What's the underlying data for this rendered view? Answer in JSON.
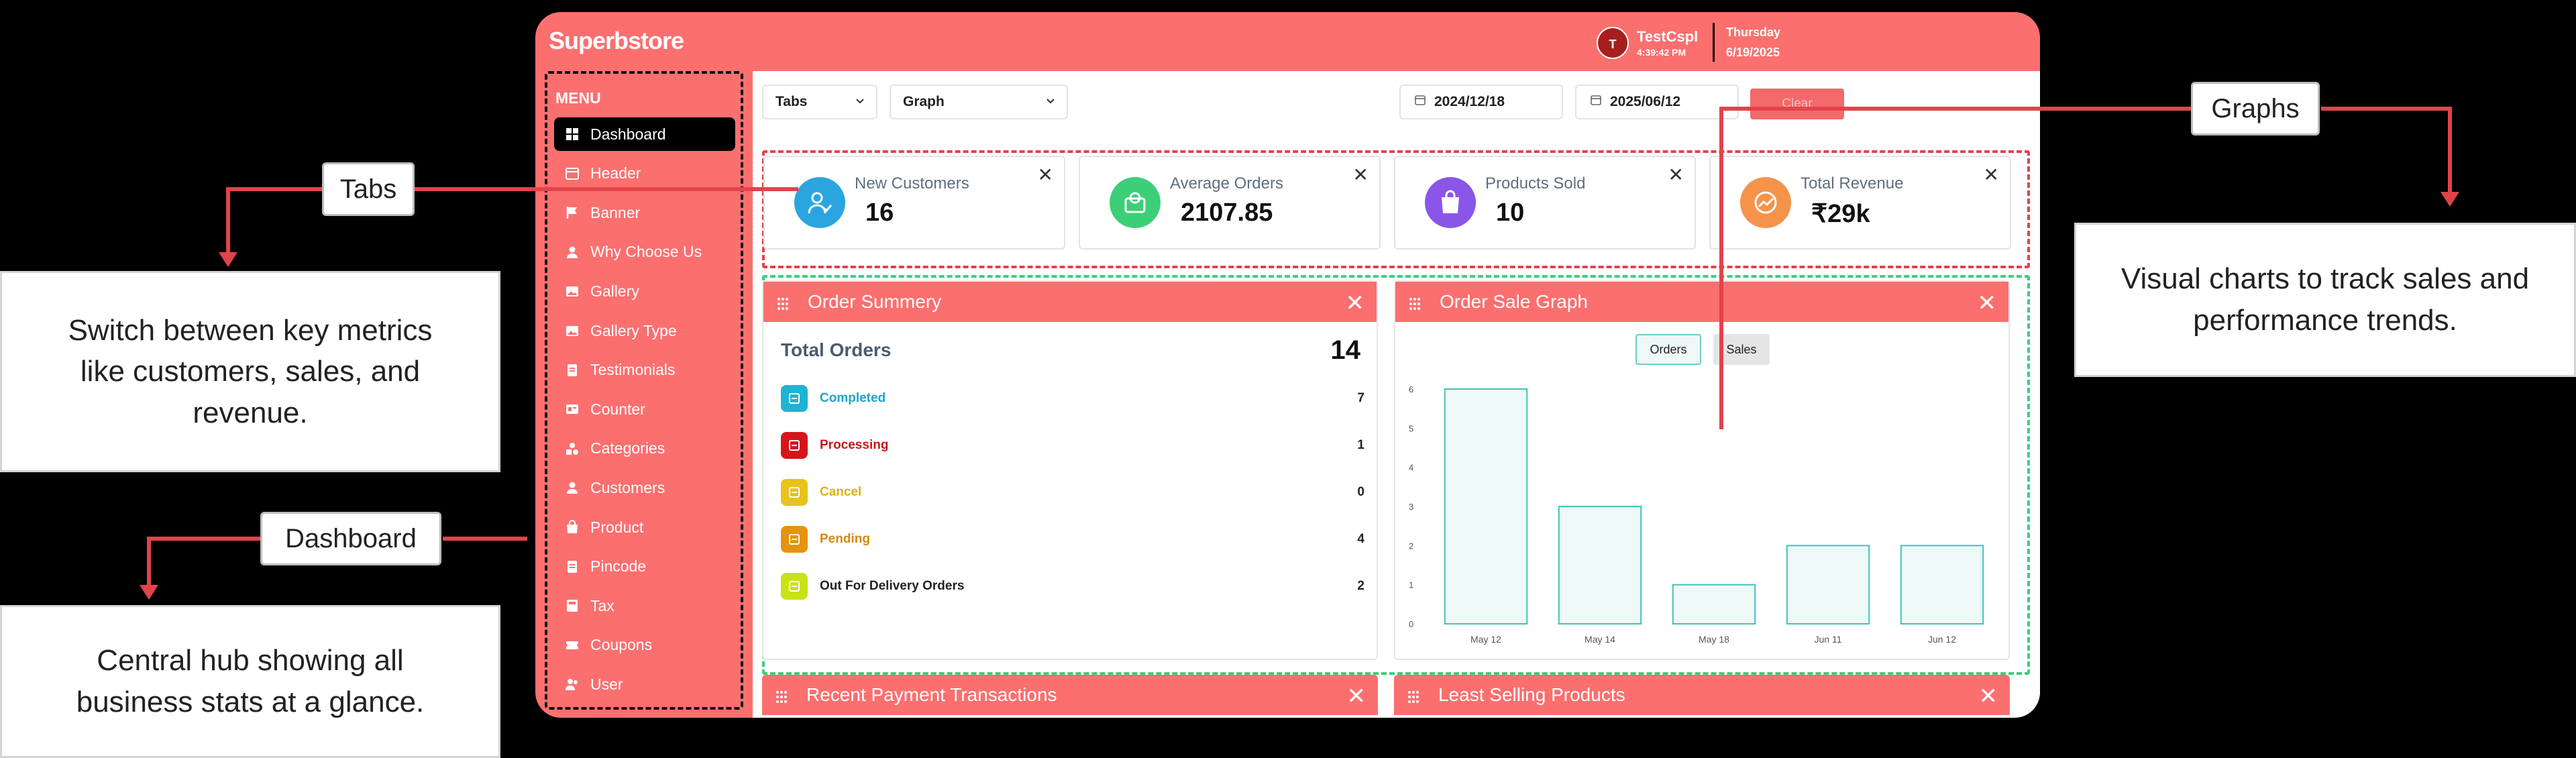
{
  "app": {
    "brand_part1": "Superb",
    "brand_part2": "store",
    "user_initial": "T",
    "user_name": "TestCspl",
    "user_time": "4:39:42 PM",
    "day": "Thursday",
    "date": "6/19/2025"
  },
  "sidebar": {
    "menu_title": "MENU",
    "items": [
      {
        "label": "Dashboard",
        "icon": "grid-icon"
      },
      {
        "label": "Header",
        "icon": "layout-icon"
      },
      {
        "label": "Banner",
        "icon": "flag-icon"
      },
      {
        "label": "Why Choose Us",
        "icon": "person-icon"
      },
      {
        "label": "Gallery",
        "icon": "image-icon"
      },
      {
        "label": "Gallery Type",
        "icon": "image-icon"
      },
      {
        "label": "Testimonials",
        "icon": "document-icon"
      },
      {
        "label": "Counter",
        "icon": "counter-icon"
      },
      {
        "label": "Categories",
        "icon": "shapes-icon"
      },
      {
        "label": "Customers",
        "icon": "person-icon"
      },
      {
        "label": "Product",
        "icon": "bag-icon"
      },
      {
        "label": "Pincode",
        "icon": "document-icon"
      },
      {
        "label": "Tax",
        "icon": "tax-icon"
      },
      {
        "label": "Coupons",
        "icon": "coupon-icon"
      },
      {
        "label": "User",
        "icon": "users-icon"
      }
    ]
  },
  "toolbar": {
    "tabs_select": "Tabs",
    "graph_select": "Graph",
    "start_date": "2024/12/18",
    "end_date": "2025/06/12",
    "clear_label": "Clear"
  },
  "cards": [
    {
      "label": "New Customers",
      "value": "16",
      "color": "#2aa5e0",
      "icon": "customers-icon"
    },
    {
      "label": "Average Orders",
      "value": "2107.85",
      "color": "#3ccf78",
      "icon": "orders-icon"
    },
    {
      "label": "Products Sold",
      "value": "10",
      "color": "#8a56e8",
      "icon": "bag-icon"
    },
    {
      "label": "Total Revenue",
      "value": "₹29k",
      "color": "#f5934a",
      "icon": "trend-icon"
    }
  ],
  "order_summary": {
    "title": "Order Summery",
    "total_label": "Total Orders",
    "total_value": "14",
    "rows": [
      {
        "label": "Completed",
        "count": "7",
        "color": "#1fb3d6",
        "text_color": "#1fa3c8"
      },
      {
        "label": "Processing",
        "count": "1",
        "color": "#d4161a",
        "text_color": "#c8161a"
      },
      {
        "label": "Cancel",
        "count": "0",
        "color": "#e9c21a",
        "text_color": "#d9b318"
      },
      {
        "label": "Pending",
        "count": "4",
        "color": "#e4940f",
        "text_color": "#d4880c"
      },
      {
        "label": "Out For Delivery Orders",
        "count": "2",
        "color": "#c9e219",
        "text_color": "#222222"
      }
    ]
  },
  "sale_graph": {
    "title": "Order Sale Graph",
    "tab_orders": "Orders",
    "tab_sales": "Sales"
  },
  "chart_data": {
    "type": "bar",
    "categories": [
      "May 12",
      "May 14",
      "May 18",
      "Jun 11",
      "Jun 12"
    ],
    "values": [
      6,
      3,
      1,
      2,
      2
    ],
    "ylim": [
      0,
      6
    ],
    "yticks": [
      "0",
      "1",
      "2",
      "3",
      "4",
      "5",
      "6"
    ],
    "bar_fill": "#eef8f7",
    "bar_stroke": "#40c3b8"
  },
  "bottom_panels": {
    "left_title": "Recent Payment Transactions",
    "right_title": "Least Selling Products"
  },
  "callouts": {
    "tabs_label": "Tabs",
    "tabs_desc": "Switch between key metrics like customers, sales, and revenue.",
    "dashboard_label": "Dashboard",
    "dashboard_desc": "Central hub showing all business stats at a glance.",
    "graphs_label": "Graphs",
    "graphs_desc": "Visual charts to track sales and performance trends."
  }
}
